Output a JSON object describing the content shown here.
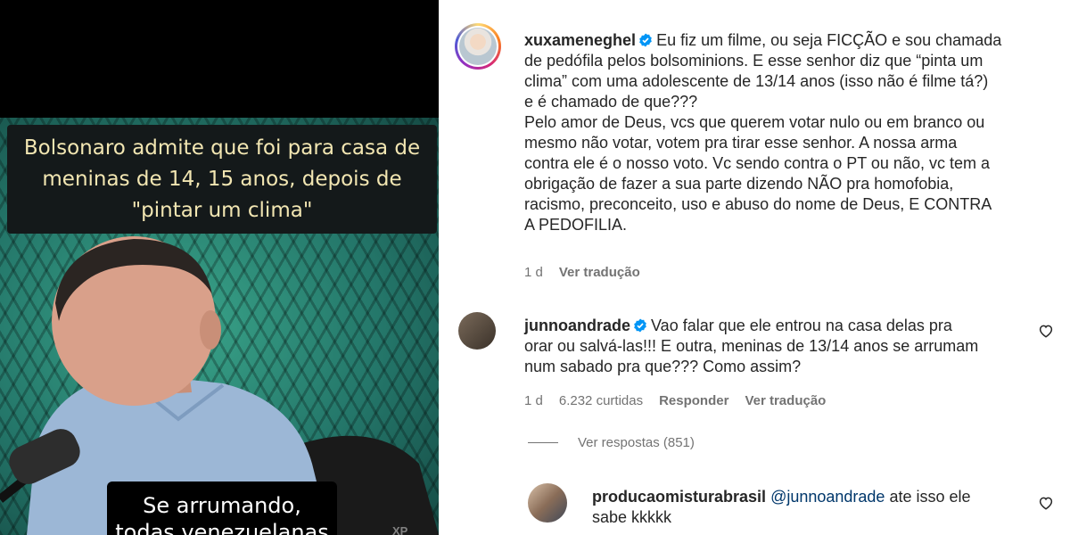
{
  "video": {
    "caption": "Bolsonaro admite que foi para casa de meninas de 14, 15 anos, depois de \"pintar um clima\"",
    "caption_lines": [
      "Bolsonaro admite que foi para casa de",
      "meninas de 14, 15 anos, depois de",
      "\"pintar um clima\""
    ],
    "subtitle_lines": [
      "Se arrumando,",
      "todas venezuelanas"
    ],
    "watermark": "XP"
  },
  "post": {
    "username": "xuxameneghel",
    "verified": true,
    "text_lines": [
      "Eu fiz um filme, ou seja FICÇÃO e sou chamada",
      "de pedófila pelos bolsominions. E esse senhor diz que “pinta um",
      "clima” com uma adolescente de 13/14 anos (isso não é filme tá?)",
      "e é chamado de que???",
      "Pelo amor de Deus, vcs que querem votar nulo ou em branco ou",
      "mesmo não votar, votem pra tirar esse senhor. A nossa arma",
      "contra ele é o nosso voto. Vc sendo contra o PT ou não, vc tem a",
      "obrigação de fazer a sua parte dizendo NÃO pra homofobia,",
      "racismo, preconceito, uso e abuso do nome de Deus, E CONTRA",
      "A PEDOFILIA."
    ],
    "time": "1 d",
    "translate": "Ver tradução"
  },
  "comment1": {
    "username": "junnoandrade",
    "verified": true,
    "text_lines": [
      "Vao falar que ele entrou na casa delas pra",
      "orar ou salvá-las!!! E outra, meninas de 13/14 anos se arrumam",
      "num sabado pra que??? Como assim?"
    ],
    "time": "1 d",
    "likes": "6.232 curtidas",
    "reply": "Responder",
    "translate": "Ver tradução"
  },
  "view_replies": "Ver respostas (851)",
  "reply1": {
    "username": "producaomisturabrasil",
    "mention": "@junnoandrade",
    "text_after_mention": " ate isso ele",
    "text_line2": "sabe kkkkk"
  },
  "colors": {
    "text": "#262626",
    "secondary": "#737373",
    "verified": "#0095f6",
    "mention": "#00376b",
    "caption_text": "#f2e6b2"
  },
  "icons": [
    "verified-badge-icon",
    "heart-icon"
  ]
}
